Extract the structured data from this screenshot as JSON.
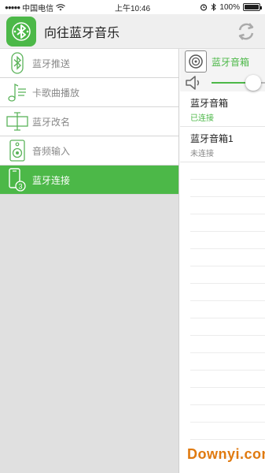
{
  "status_bar": {
    "carrier": "中国电信",
    "time": "上午10:46",
    "battery": "100%",
    "battery_level": 1.0
  },
  "header": {
    "title": "向往蓝牙音乐",
    "app_icon": "bluetooth-icon",
    "refresh_icon": "refresh-icon"
  },
  "sidebar": {
    "items": [
      {
        "label": "蓝牙推送",
        "icon": "bluetooth-icon",
        "active": false
      },
      {
        "label": "卡歌曲播放",
        "icon": "music-note-icon",
        "active": false
      },
      {
        "label": "蓝牙改名",
        "icon": "rename-icon",
        "active": false
      },
      {
        "label": "音频输入",
        "icon": "speaker-icon",
        "active": false
      },
      {
        "label": "蓝牙连接",
        "icon": "phone-connect-icon",
        "active": true
      }
    ]
  },
  "right_panel": {
    "device_title": "蓝牙音箱",
    "volume_level": 0.78,
    "devices": [
      {
        "name": "蓝牙音箱",
        "status": "已连接",
        "connected": true
      },
      {
        "name": "蓝牙音箱1",
        "status": "未连接",
        "connected": false
      }
    ]
  },
  "watermark": "Downyi.com",
  "colors": {
    "accent": "#4cb848",
    "watermark": "#e07a10"
  }
}
